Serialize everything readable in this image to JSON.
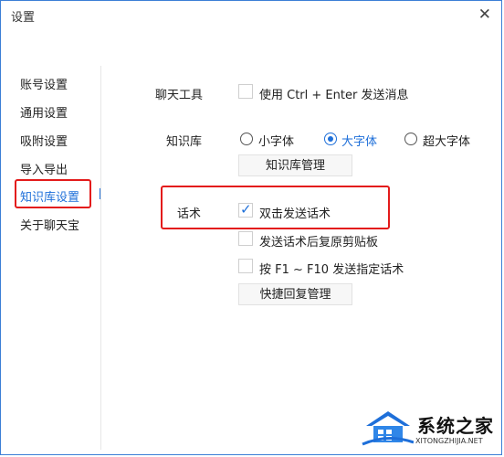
{
  "window": {
    "title": "设置",
    "close_glyph": "✕"
  },
  "sidebar": {
    "items": [
      {
        "label": "账号设置",
        "active": false
      },
      {
        "label": "通用设置",
        "active": false
      },
      {
        "label": "吸附设置",
        "active": false
      },
      {
        "label": "导入导出",
        "active": false
      },
      {
        "label": "知识库设置",
        "active": true
      },
      {
        "label": "关于聊天宝",
        "active": false
      }
    ]
  },
  "chat_tools": {
    "label": "聊天工具",
    "ctrl_enter": {
      "label": "使用 Ctrl + Enter 发送消息",
      "checked": false
    }
  },
  "knowledge_base": {
    "label": "知识库",
    "font_options": [
      {
        "label": "小字体",
        "selected": false
      },
      {
        "label": "大字体",
        "selected": true
      },
      {
        "label": "超大字体",
        "selected": false
      }
    ],
    "manage_button": "知识库管理"
  },
  "phrases": {
    "label": "话术",
    "double_click_send": {
      "label": "双击发送话术",
      "checked": true
    },
    "restore_clipboard": {
      "label": "发送话术后复原剪贴板",
      "checked": false
    },
    "f_keys": {
      "label": "按 F1 ~ F10 发送指定话术",
      "checked": false
    },
    "quick_reply_button": "快捷回复管理"
  },
  "watermark": {
    "text": "系统之家",
    "url": "XITONGZHIJIA.NET"
  },
  "colors": {
    "accent": "#1e6fd9",
    "highlight_border": "#e31b1b",
    "window_border": "#3c7fd6"
  }
}
